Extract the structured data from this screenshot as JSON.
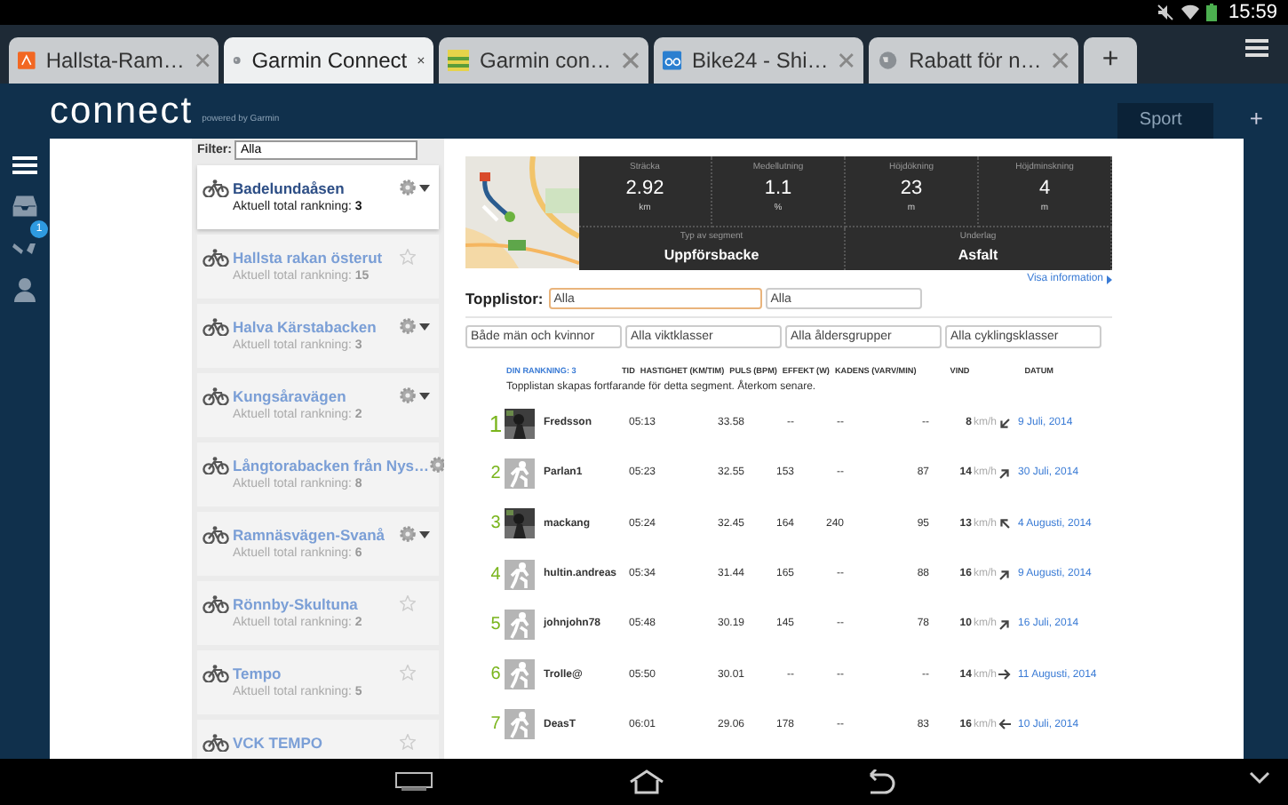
{
  "status_bar": {
    "time": "15:59"
  },
  "browser": {
    "tabs": [
      {
        "label": "Hallsta-Ram…",
        "kind": "orange",
        "selected": false
      },
      {
        "label": "Garmin Connect",
        "kind": "globe",
        "selected": true
      },
      {
        "label": "Garmin con…",
        "kind": "stripes",
        "selected": false
      },
      {
        "label": "Bike24 - Shi…",
        "kind": "blue",
        "selected": false
      },
      {
        "label": "Rabatt för n…",
        "kind": "globe",
        "selected": false
      }
    ],
    "new_tab": "+"
  },
  "header": {
    "logo": "connect",
    "tagline": "powered by Garmin",
    "sport_button": "Sport",
    "add": "+"
  },
  "side_nav": {
    "badge": "1"
  },
  "segments": {
    "filter_label": "Filter:",
    "filter_value": "Alla",
    "items": [
      {
        "name": "Badelundaåsen",
        "rank": "Aktuell total rankning: **3**",
        "selected": true,
        "kind": "gear"
      },
      {
        "name": "Hallsta rakan österut",
        "rank": "Aktuell total rankning: **15**",
        "selected": false,
        "kind": "star"
      },
      {
        "name": "Halva Kärstabacken",
        "rank": "Aktuell total rankning: **3**",
        "selected": false,
        "kind": "gear"
      },
      {
        "name": "Kungsåravägen",
        "rank": "Aktuell total rankning: **2**",
        "selected": false,
        "kind": "gear"
      },
      {
        "name": "Långtorabacken från Nys…",
        "rank": "Aktuell total rankning: **8**",
        "selected": false,
        "kind": "gear"
      },
      {
        "name": "Ramnäsvägen-Svanå",
        "rank": "Aktuell total rankning: **6**",
        "selected": false,
        "kind": "gear"
      },
      {
        "name": "Rönnby-Skultuna",
        "rank": "Aktuell total rankning: **2**",
        "selected": false,
        "kind": "star"
      },
      {
        "name": "Tempo",
        "rank": "Aktuell total rankning: **5**",
        "selected": false,
        "kind": "star"
      },
      {
        "name": "VCK TEMPO",
        "selected": false,
        "kind": "star"
      }
    ]
  },
  "segment": {
    "stats": [
      {
        "label": "Sträcka",
        "value": "2.92",
        "unit": "km"
      },
      {
        "label": "Medellutning",
        "value": "1.1",
        "unit": "%"
      },
      {
        "label": "Höjdökning",
        "value": "23",
        "unit": "m"
      },
      {
        "label": "Höjdminskning",
        "value": "4",
        "unit": "m"
      }
    ],
    "details": [
      {
        "label": "Typ av segment",
        "value": "Uppförsbacke"
      },
      {
        "label": "Underlag",
        "value": "Asfalt"
      }
    ],
    "info_link": "Visa information"
  },
  "leaderboard": {
    "label": "Topplistor:",
    "selects": [
      "Alla",
      "Alla"
    ],
    "filters": [
      "Både män och kvinnor",
      "Alla viktklasser",
      "Alla åldersgrupper",
      "Alla cyklingsklasser"
    ],
    "columns": [
      "DIN RANKNING: 3",
      "TID",
      "HASTIGHET (KM/TIM)",
      "PULS (BPM)",
      "EFFEKT (W)",
      "KADENS (VARV/MIN)",
      "VIND",
      "DATUM"
    ],
    "note": "Topplistan skapas fortfarande för detta segment. Återkom senare.",
    "rows": [
      {
        "rank": "1",
        "name": "Fredsson",
        "time": "05:13",
        "speed": "33.58",
        "pulse": "--",
        "power": "--",
        "cadence": "--",
        "wind": {
          "kind": "sw",
          "speed": "8",
          "unit": "km/h"
        },
        "date": "9 Juli, 2014"
      },
      {
        "rank": "2",
        "avatar": {
          "kind": "default"
        },
        "name": "Parlan1",
        "time": "05:23",
        "speed": "32.55",
        "pulse": "153",
        "power": "--",
        "cadence": "87",
        "wind": {
          "kind": "ne",
          "speed": "14",
          "unit": "km/h"
        },
        "date": "30 Juli, 2014"
      },
      {
        "rank": "3",
        "name": "mackang",
        "time": "05:24",
        "speed": "32.45",
        "pulse": "164",
        "power": "240",
        "cadence": "95",
        "wind": {
          "kind": "nw",
          "speed": "13",
          "unit": "km/h"
        },
        "date": "4 Augusti, 2014"
      },
      {
        "rank": "4",
        "avatar": {
          "kind": "default"
        },
        "name": "hultin.andreas",
        "time": "05:34",
        "speed": "31.44",
        "pulse": "165",
        "power": "--",
        "cadence": "88",
        "wind": {
          "kind": "ne",
          "speed": "16",
          "unit": "km/h"
        },
        "date": "9 Augusti, 2014"
      },
      {
        "rank": "5",
        "avatar": {
          "kind": "default"
        },
        "name": "johnjohn78",
        "time": "05:48",
        "speed": "30.19",
        "pulse": "145",
        "power": "--",
        "cadence": "78",
        "wind": {
          "kind": "ne",
          "speed": "10",
          "unit": "km/h"
        },
        "date": "16 Juli, 2014"
      },
      {
        "rank": "6",
        "avatar": {
          "kind": "default"
        },
        "name": "Trolle@",
        "time": "05:50",
        "speed": "30.01",
        "pulse": "--",
        "power": "--",
        "cadence": "--",
        "wind": {
          "kind": "e",
          "speed": "14",
          "unit": "km/h"
        },
        "date": "11 Augusti, 2014"
      },
      {
        "rank": "7",
        "avatar": {
          "kind": "default"
        },
        "name": "DeasT",
        "time": "06:01",
        "speed": "29.06",
        "pulse": "178",
        "power": "--",
        "cadence": "83",
        "wind": {
          "kind": "w",
          "speed": "16",
          "unit": "km/h"
        },
        "date": "10 Juli, 2014"
      }
    ]
  }
}
